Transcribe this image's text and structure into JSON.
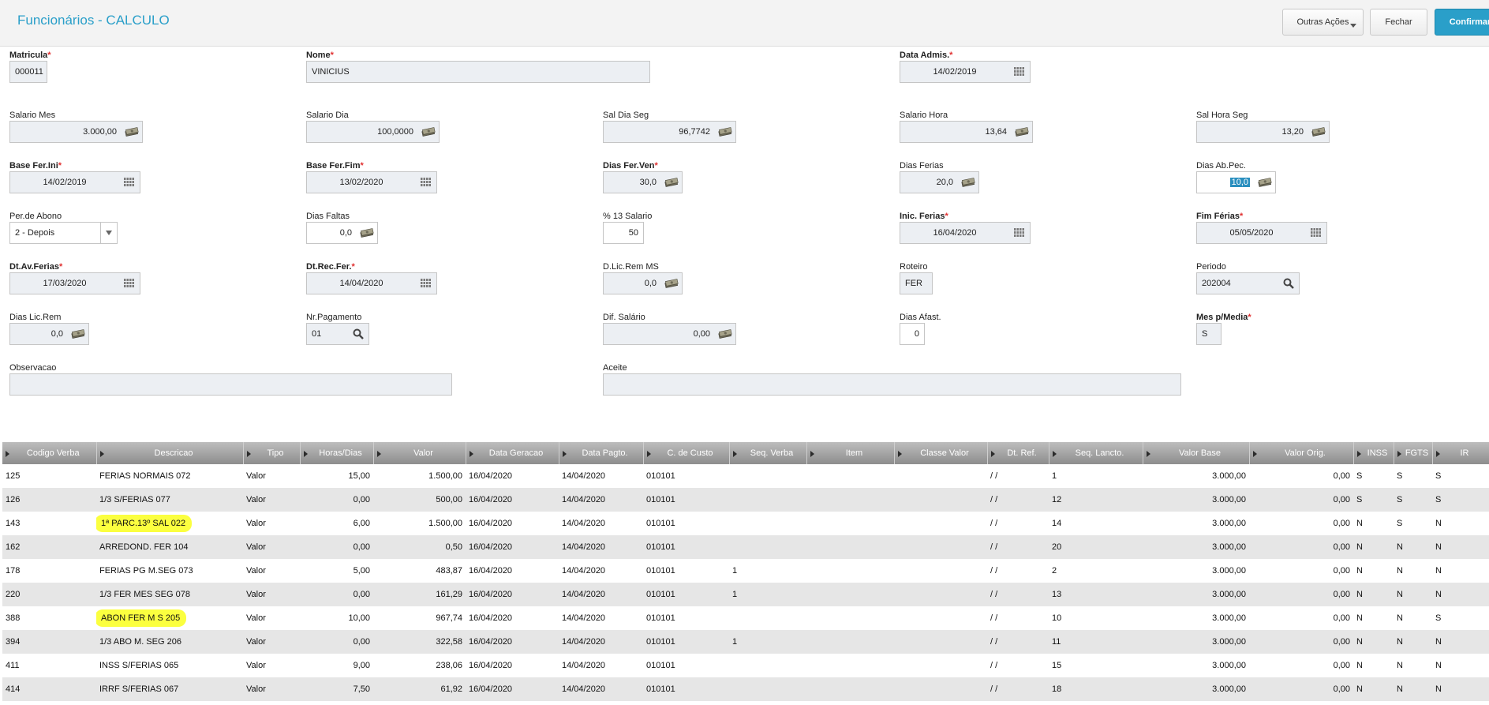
{
  "header": {
    "title": "Funcionários - CALCULO",
    "outras_acoes": "Outras Ações",
    "fechar": "Fechar",
    "confirmar": "Confirmar"
  },
  "form": {
    "matricula": {
      "label": "Matricula",
      "value": "000011"
    },
    "nome": {
      "label": "Nome",
      "value": "VINICIUS"
    },
    "data_admis": {
      "label": "Data Admis.",
      "value": "14/02/2019"
    },
    "salario_mes": {
      "label": "Salario Mes",
      "value": "3.000,00"
    },
    "salario_dia": {
      "label": "Salario Dia",
      "value": "100,0000"
    },
    "sal_dia_seg": {
      "label": "Sal Dia Seg",
      "value": "96,7742"
    },
    "salario_hora": {
      "label": "Salario Hora",
      "value": "13,64"
    },
    "sal_hora_seg": {
      "label": "Sal Hora Seg",
      "value": "13,20"
    },
    "base_fer_ini": {
      "label": "Base Fer.Ini",
      "value": "14/02/2019"
    },
    "base_fer_fim": {
      "label": "Base Fer.Fim",
      "value": "13/02/2020"
    },
    "dias_fer_ven": {
      "label": "Dias Fer.Ven",
      "value": "30,0"
    },
    "dias_ferias": {
      "label": "Dias Ferias",
      "value": "20,0"
    },
    "dias_ab_pec": {
      "label": "Dias Ab.Pec.",
      "value": "10,0"
    },
    "per_de_abono": {
      "label": "Per.de Abono",
      "value": "2 - Depois"
    },
    "dias_faltas": {
      "label": "Dias Faltas",
      "value": "0,0"
    },
    "pct_13_salario": {
      "label": "% 13 Salario",
      "value": "50"
    },
    "inic_ferias": {
      "label": "Inic. Ferias",
      "value": "16/04/2020"
    },
    "fim_ferias": {
      "label": "Fim Férias",
      "value": "05/05/2020"
    },
    "dt_av_ferias": {
      "label": "Dt.Av.Ferias",
      "value": "17/03/2020"
    },
    "dt_rec_fer": {
      "label": "Dt.Rec.Fer.",
      "value": "14/04/2020"
    },
    "d_lic_rem_ms": {
      "label": "D.Lic.Rem MS",
      "value": "0,0"
    },
    "roteiro": {
      "label": "Roteiro",
      "value": "FER"
    },
    "periodo": {
      "label": "Periodo",
      "value": "202004"
    },
    "dias_lic_rem": {
      "label": "Dias Lic.Rem",
      "value": "0,0"
    },
    "nr_pagamento": {
      "label": "Nr.Pagamento",
      "value": "01"
    },
    "dif_salario": {
      "label": "Dif. Salário",
      "value": "0,00"
    },
    "dias_afast": {
      "label": "Dias Afast.",
      "value": "0"
    },
    "mes_p_media": {
      "label": "Mes p/Media",
      "value": "S"
    },
    "observacao": {
      "label": "Observacao",
      "value": ""
    },
    "aceite": {
      "label": "Aceite",
      "value": ""
    }
  },
  "grid": {
    "columns": [
      "Codigo Verba",
      "Descricao",
      "Tipo",
      "Horas/Dias",
      "Valor",
      "Data Geracao",
      "Data Pagto.",
      "C. de Custo",
      "Seq. Verba",
      "Item",
      "Classe Valor",
      "Dt. Ref.",
      "Seq. Lancto.",
      "Valor Base",
      "Valor Orig.",
      "INSS",
      "FGTS",
      "IR"
    ],
    "rows": [
      [
        "125",
        "FERIAS NORMAIS 072",
        "Valor",
        "15,00",
        "1.500,00",
        "16/04/2020",
        "14/04/2020",
        "010101",
        "",
        "",
        "",
        " /  /",
        "1",
        "3.000,00",
        "0,00",
        "S",
        "S",
        "S"
      ],
      [
        "126",
        "1/3 S/FERIAS 077",
        "Valor",
        "0,00",
        "500,00",
        "16/04/2020",
        "14/04/2020",
        "010101",
        "",
        "",
        "",
        " /  /",
        "12",
        "3.000,00",
        "0,00",
        "S",
        "S",
        "S"
      ],
      [
        "143",
        "1ª PARC.13º SAL 022",
        "Valor",
        "6,00",
        "1.500,00",
        "16/04/2020",
        "14/04/2020",
        "010101",
        "",
        "",
        "",
        " /  /",
        "14",
        "3.000,00",
        "0,00",
        "N",
        "S",
        "N"
      ],
      [
        "162",
        "ARREDOND. FER 104",
        "Valor",
        "0,00",
        "0,50",
        "16/04/2020",
        "14/04/2020",
        "010101",
        "",
        "",
        "",
        " /  /",
        "20",
        "3.000,00",
        "0,00",
        "N",
        "N",
        "N"
      ],
      [
        "178",
        "FERIAS PG M.SEG 073",
        "Valor",
        "5,00",
        "483,87",
        "16/04/2020",
        "14/04/2020",
        "010101",
        "1",
        "",
        "",
        " /  /",
        "2",
        "3.000,00",
        "0,00",
        "N",
        "N",
        "N"
      ],
      [
        "220",
        "1/3 FER MES SEG 078",
        "Valor",
        "0,00",
        "161,29",
        "16/04/2020",
        "14/04/2020",
        "010101",
        "1",
        "",
        "",
        " /  /",
        "13",
        "3.000,00",
        "0,00",
        "N",
        "N",
        "N"
      ],
      [
        "388",
        "ABON FER M S 205",
        "Valor",
        "10,00",
        "967,74",
        "16/04/2020",
        "14/04/2020",
        "010101",
        "",
        "",
        "",
        " /  /",
        "10",
        "3.000,00",
        "0,00",
        "N",
        "N",
        "S"
      ],
      [
        "394",
        "1/3 ABO M. SEG 206",
        "Valor",
        "0,00",
        "322,58",
        "16/04/2020",
        "14/04/2020",
        "010101",
        "1",
        "",
        "",
        " /  /",
        "11",
        "3.000,00",
        "0,00",
        "N",
        "N",
        "N"
      ],
      [
        "411",
        "INSS  S/FERIAS 065",
        "Valor",
        "9,00",
        "238,06",
        "16/04/2020",
        "14/04/2020",
        "010101",
        "",
        "",
        "",
        " /  /",
        "15",
        "3.000,00",
        "0,00",
        "N",
        "N",
        "N"
      ],
      [
        "414",
        "IRRF S/FERIAS 067",
        "Valor",
        "7,50",
        "61,92",
        "16/04/2020",
        "14/04/2020",
        "010101",
        "",
        "",
        "",
        " /  /",
        "18",
        "3.000,00",
        "0,00",
        "N",
        "N",
        "N"
      ]
    ]
  },
  "colors": {
    "accent": "#2a9fc9",
    "required": "#e03030",
    "highlight": "#fbff3f",
    "selection": "#2a8fbf"
  },
  "icons": {
    "money": "money-icon",
    "calendar": "calendar-icon",
    "search": "search-icon",
    "dropdown": "chevron-down-icon"
  }
}
